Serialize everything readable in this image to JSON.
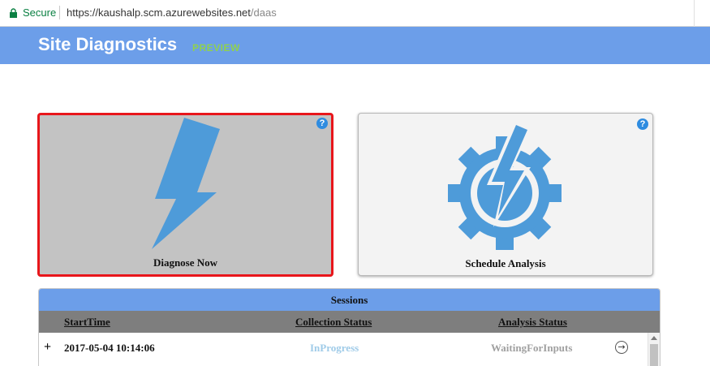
{
  "browser": {
    "secure_label": "Secure",
    "url_base": "https://kaushalp.scm.azurewebsites.net",
    "url_path": "/daas"
  },
  "header": {
    "title": "Site Diagnostics",
    "badge": "PREVIEW"
  },
  "tiles": [
    {
      "label": "Diagnose Now",
      "help": "?",
      "icon": "lightning-bolt-icon",
      "selected": true
    },
    {
      "label": "Schedule Analysis",
      "help": "?",
      "icon": "gear-lightning-icon",
      "selected": false
    }
  ],
  "sessions": {
    "title": "Sessions",
    "columns": [
      "StartTime",
      "Collection Status",
      "Analysis Status"
    ],
    "rows": [
      {
        "expand": "+",
        "start_time": "2017-05-04 10:14:06",
        "collection_status": "InProgress",
        "analysis_status": "WaitingForInputs",
        "action_icon": "arrow-circle-icon"
      }
    ]
  },
  "colors": {
    "header": "#6c9ee9",
    "preview_badge": "#8fd14f",
    "selected_border": "#e8161b",
    "icon_blue": "#4e9bd9",
    "help_blue": "#2f8ce0",
    "in_progress": "#9fcbe8",
    "waiting": "#a0a0a0"
  }
}
